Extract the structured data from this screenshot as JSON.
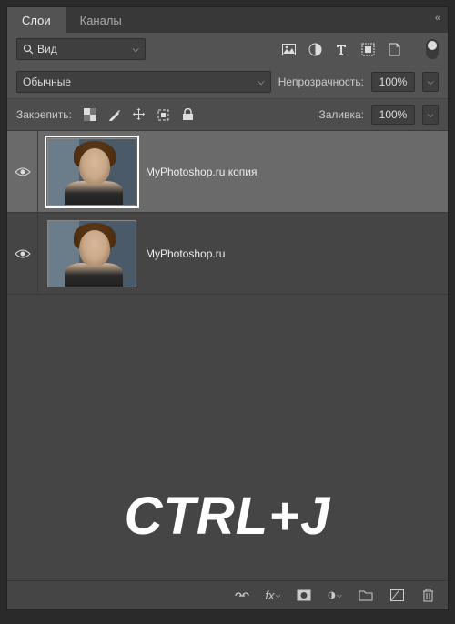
{
  "tabs": {
    "layers": "Слои",
    "channels": "Каналы"
  },
  "filter": {
    "label": "Вид"
  },
  "blend": {
    "mode": "Обычные",
    "opacity_label": "Непрозрачность:",
    "opacity": "100%"
  },
  "lock": {
    "label": "Закрепить:",
    "fill_label": "Заливка:",
    "fill": "100%"
  },
  "layers": [
    {
      "name": "MyPhotoshop.ru копия",
      "selected": true
    },
    {
      "name": "MyPhotoshop.ru",
      "selected": false
    }
  ],
  "overlay": "CTRL+J"
}
